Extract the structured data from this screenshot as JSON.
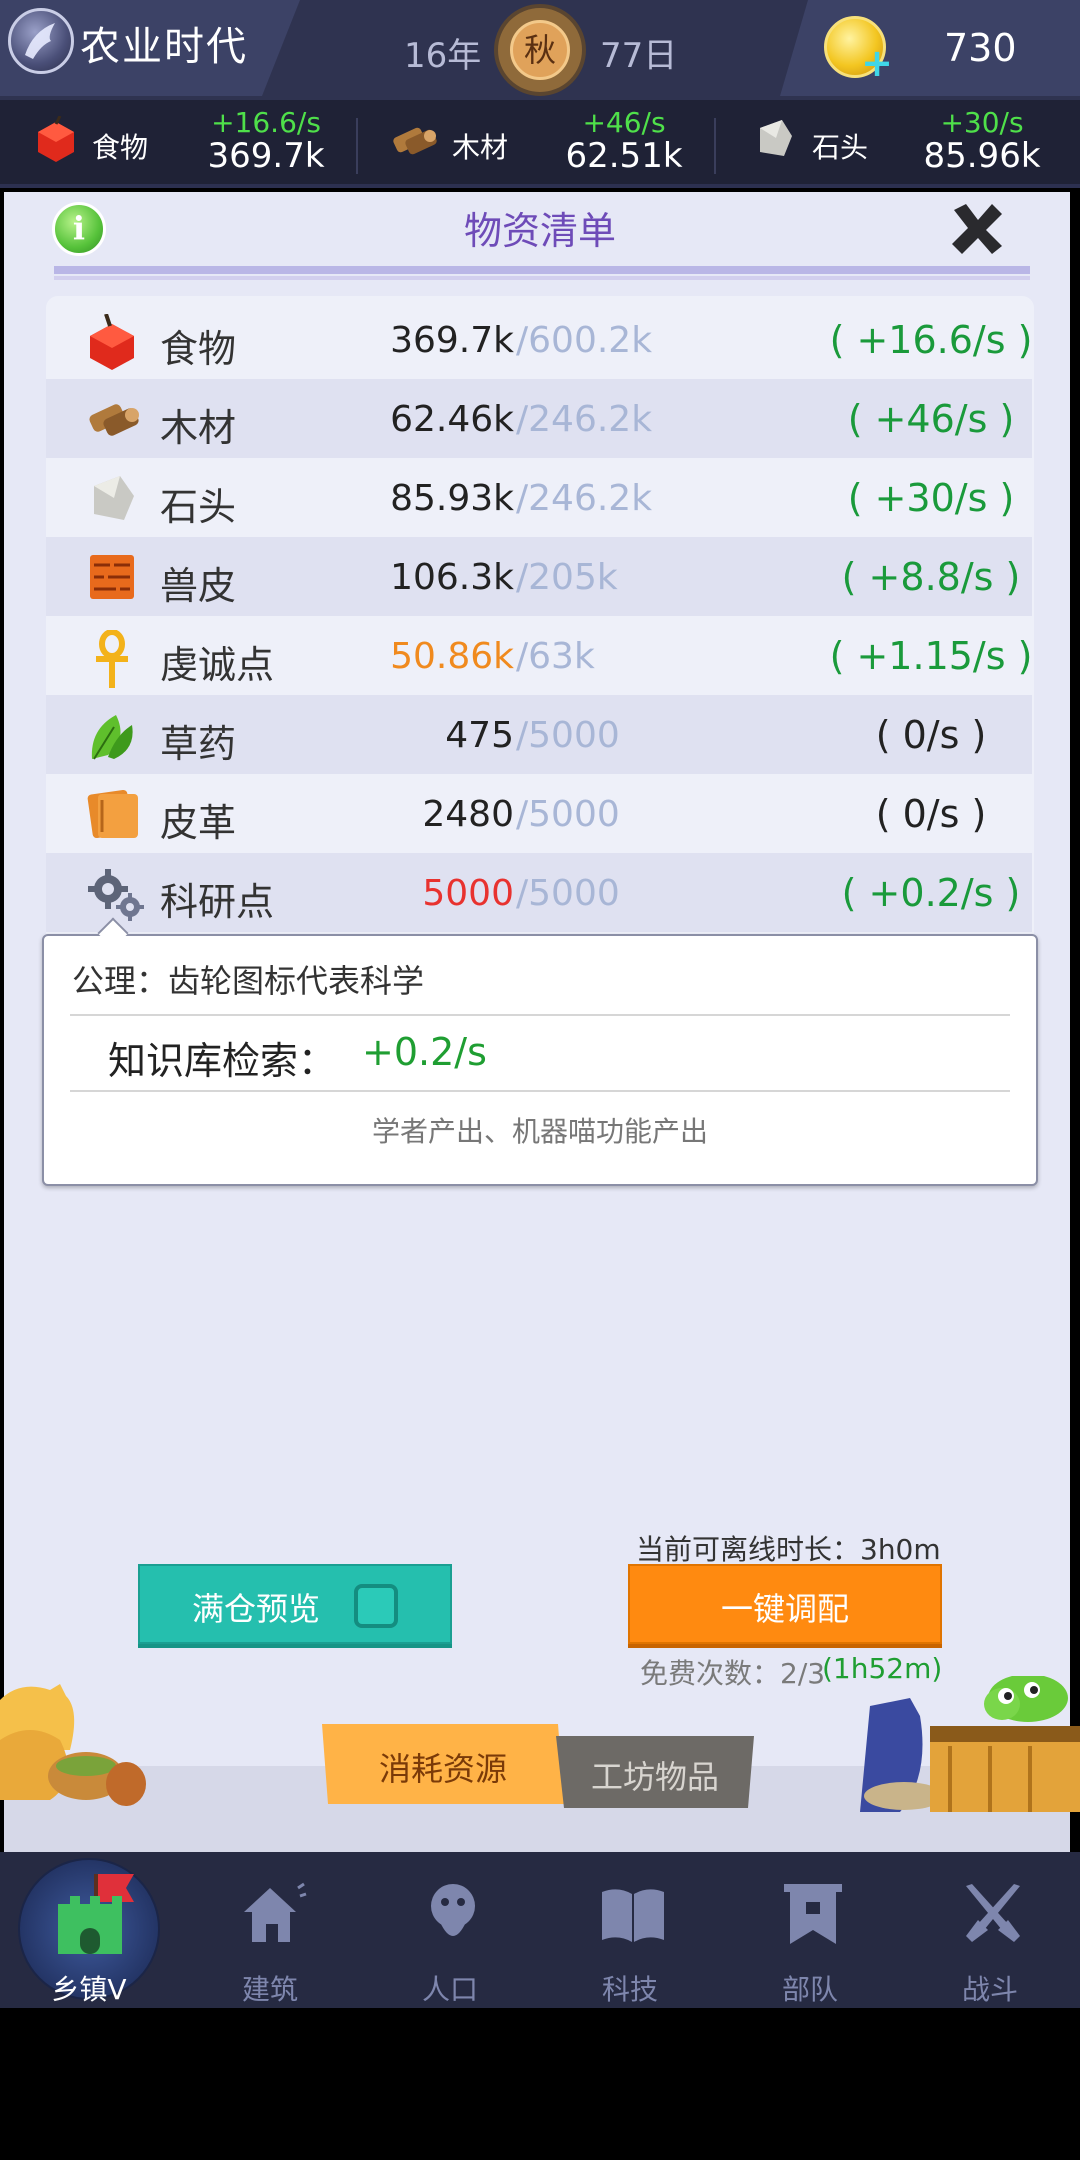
{
  "header": {
    "title": "农业时代",
    "year": "16年",
    "season": "秋",
    "day": "77日",
    "gold": "730"
  },
  "resource_strip": [
    {
      "name": "食物",
      "rate": "+16.6/s",
      "total": "369.7k",
      "icon": "apple-icon"
    },
    {
      "name": "木材",
      "rate": "+46/s",
      "total": "62.51k",
      "icon": "wood-icon"
    },
    {
      "name": "石头",
      "rate": "+30/s",
      "total": "85.96k",
      "icon": "stone-icon"
    }
  ],
  "panel": {
    "title": "物资清单",
    "rows": [
      {
        "name": "食物",
        "current": "369.7k",
        "capacity": "/600.2k",
        "rate": "( +16.6/s )",
        "icon": "apple-icon"
      },
      {
        "name": "木材",
        "current": "62.46k",
        "capacity": "/246.2k",
        "rate": "( +46/s )",
        "icon": "wood-icon"
      },
      {
        "name": "石头",
        "current": "85.93k",
        "capacity": "/246.2k",
        "rate": "( +30/s )",
        "icon": "stone-icon"
      },
      {
        "name": "兽皮",
        "current": "106.3k",
        "capacity": "/205k",
        "rate": "( +8.8/s )",
        "icon": "hide-icon"
      },
      {
        "name": "虔诚点",
        "current": "50.86k",
        "capacity": "/63k",
        "rate": "( +1.15/s )",
        "icon": "ankh-icon"
      },
      {
        "name": "草药",
        "current": "475",
        "capacity": "/5000",
        "rate": "( 0/s )",
        "icon": "herb-icon"
      },
      {
        "name": "皮革",
        "current": "2480",
        "capacity": "/5000",
        "rate": "( 0/s )",
        "icon": "leather-icon"
      },
      {
        "name": "科研点",
        "current": "5000",
        "capacity": "/5000",
        "rate": "( +0.2/s )",
        "icon": "gears-icon"
      }
    ],
    "colors": {
      "rate_positive": "#1a9a3b",
      "warning": "#f08a1e",
      "full": "#e8322f",
      "capacity": "#a8b6d6"
    }
  },
  "tooltip": {
    "title": "公理：齿轮图标代表科学",
    "source_label": "知识库检索：",
    "source_value": "+0.2/s",
    "note": "学者产出、机器喵功能产出"
  },
  "controls": {
    "offline_label": "当前可离线时长：3h0m",
    "preview_label": "满仓预览",
    "dispatch_label": "一键调配",
    "free_label": "免费次数：2/3",
    "free_timer": "(1h52m)",
    "tab_consume": "消耗资源",
    "tab_workshop": "工坊物品"
  },
  "nav": [
    {
      "label": "乡镇V",
      "icon": "castle-icon",
      "active": true
    },
    {
      "label": "建筑",
      "icon": "house-icon"
    },
    {
      "label": "人口",
      "icon": "person-icon"
    },
    {
      "label": "科技",
      "icon": "book-icon"
    },
    {
      "label": "部队",
      "icon": "banner-icon"
    },
    {
      "label": "战斗",
      "icon": "swords-icon"
    }
  ]
}
